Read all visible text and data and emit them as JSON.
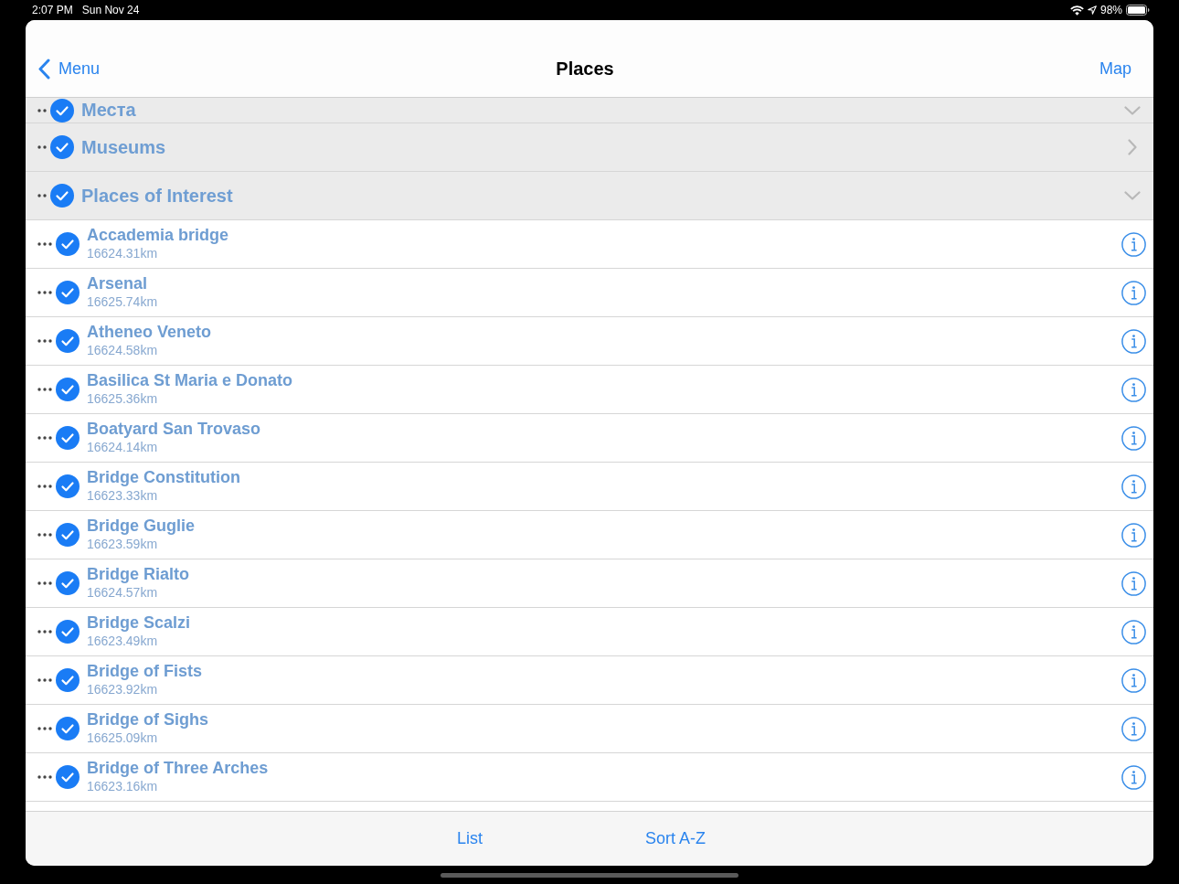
{
  "status_bar": {
    "time": "2:07 PM",
    "date": "Sun Nov 24",
    "battery": "98%"
  },
  "nav_bar": {
    "back": "Menu",
    "title": "Places",
    "action": "Map"
  },
  "groups": [
    {
      "name": "Места",
      "checked": true,
      "expanded": true
    },
    {
      "name": "Museums",
      "checked": true,
      "expanded": false
    },
    {
      "name": "Places of Interest",
      "checked": true,
      "expanded": true,
      "items": [
        {
          "name": "Accademia bridge",
          "distance": "16624.31km",
          "checked": true
        },
        {
          "name": "Arsenal",
          "distance": "16625.74km",
          "checked": true
        },
        {
          "name": "Atheneo Veneto",
          "distance": "16624.58km",
          "checked": true
        },
        {
          "name": "Basilica St Maria e Donato",
          "distance": "16625.36km",
          "checked": true
        },
        {
          "name": "Boatyard San Trovaso",
          "distance": "16624.14km",
          "checked": true
        },
        {
          "name": "Bridge Constitution",
          "distance": "16623.33km",
          "checked": true
        },
        {
          "name": "Bridge Guglie",
          "distance": "16623.59km",
          "checked": true
        },
        {
          "name": "Bridge Rialto",
          "distance": "16624.57km",
          "checked": true
        },
        {
          "name": "Bridge Scalzi",
          "distance": "16623.49km",
          "checked": true
        },
        {
          "name": "Bridge of Fists",
          "distance": "16623.92km",
          "checked": true
        },
        {
          "name": "Bridge of Sighs",
          "distance": "16625.09km",
          "checked": true
        },
        {
          "name": "Bridge of Three Arches",
          "distance": "16623.16km",
          "checked": true
        }
      ]
    }
  ],
  "toolbar": [
    "List",
    "Sort A-Z"
  ]
}
